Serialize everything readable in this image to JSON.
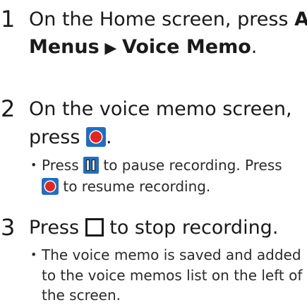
{
  "steps": [
    {
      "number": "1",
      "line1_prefix": "On the Home screen, press ",
      "line1_bold": "All",
      "line2_bold_a": "Menus",
      "line2_arrow": " ▶ ",
      "line2_bold_b": "Voice Memo",
      "line2_suffix": "."
    },
    {
      "number": "2",
      "line1": "On the voice memo screen,",
      "line2_prefix": "press ",
      "line2_suffix": ".",
      "bullet": {
        "line1_prefix": "Press ",
        "line1_suffix": " to pause recording. Press",
        "line2_suffix": " to resume recording."
      }
    },
    {
      "number": "3",
      "line1_prefix": "Press ",
      "line1_suffix": " to stop recording.",
      "bullet": {
        "line1": "The voice memo is saved and added",
        "line2": "to the voice memos list on the left of",
        "line3": "the screen."
      }
    }
  ],
  "bullet_char": "•",
  "icons": {
    "record": "record-icon",
    "pause": "pause-icon",
    "stop": "stop-icon"
  },
  "colors": {
    "icon_blue": "#1e6fc4",
    "record_red": "#e8241f",
    "text": "#1a1a1a"
  }
}
